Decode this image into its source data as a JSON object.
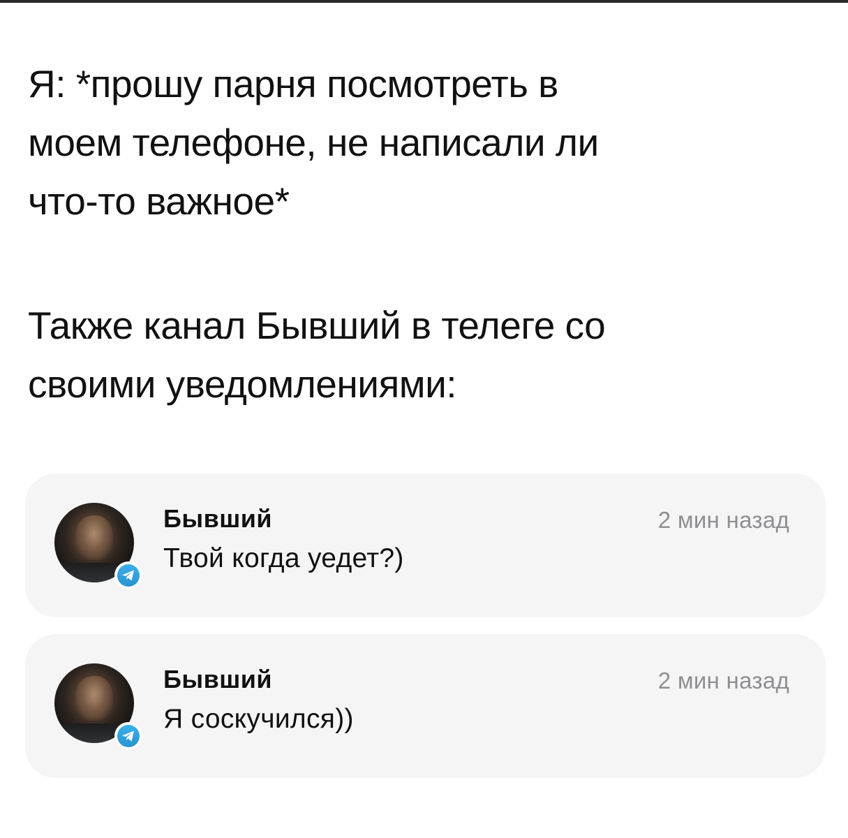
{
  "post": {
    "caption_line_1": "Я: *прошу парня посмотреть в\nмоем телефоне, не написали ли\nчто-то важное*",
    "caption_line_2": "Также канал Бывший в телеге со\nсвоими уведомлениями:"
  },
  "notifications": [
    {
      "app_icon": "telegram-icon",
      "sender": "Бывший",
      "message": "Твой когда уедет?)",
      "time": "2 мин назад"
    },
    {
      "app_icon": "telegram-icon",
      "sender": "Бывший",
      "message": "Я соскучился))",
      "time": "2 мин назад"
    }
  ],
  "colors": {
    "card_background": "#f5f5f5",
    "telegram_blue": "#2a93d2",
    "time_gray": "#8e8e93"
  }
}
